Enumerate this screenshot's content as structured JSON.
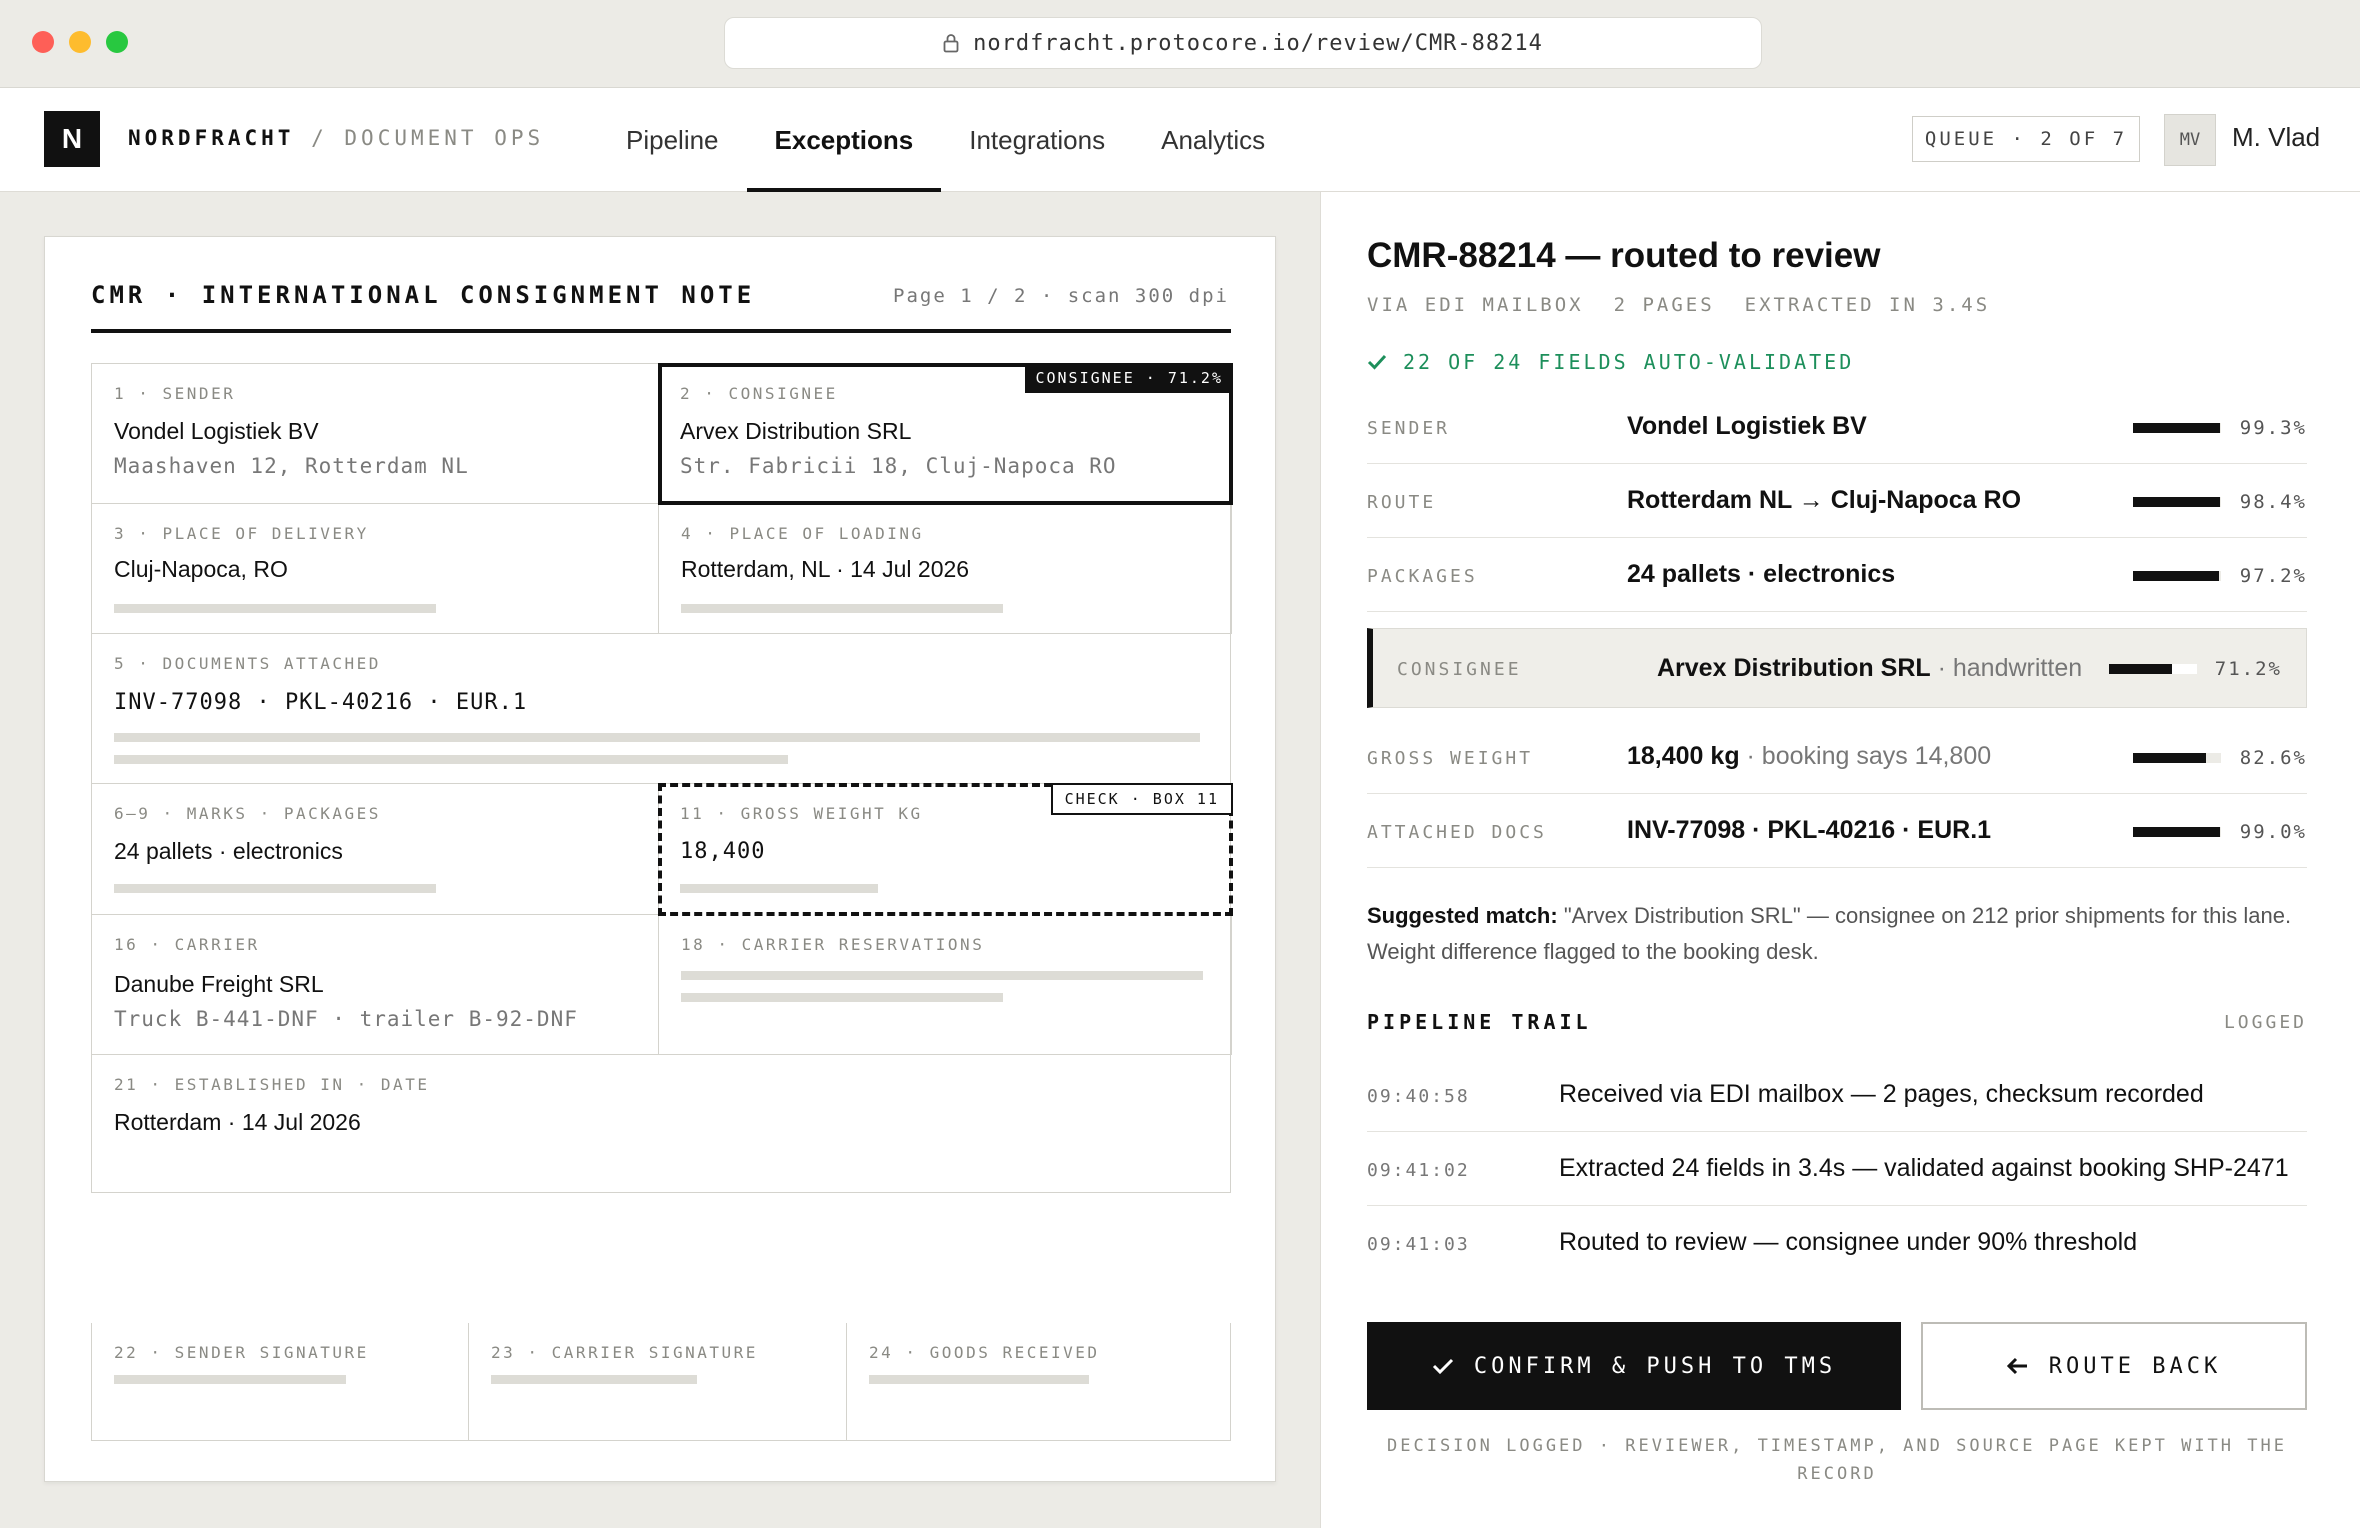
{
  "browser": {
    "url": "nordfracht.protocore.io/review/CMR-88214"
  },
  "header": {
    "logo": "N",
    "brand": "NORDFRACHT",
    "brand_sep": "/",
    "section": "DOCUMENT OPS",
    "nav": [
      "Pipeline",
      "Exceptions",
      "Integrations",
      "Analytics"
    ],
    "active_nav": "Exceptions",
    "queue": "QUEUE · 2 OF 7",
    "avatar": "MV",
    "user": "M. Vlad"
  },
  "document": {
    "title": "CMR · INTERNATIONAL CONSIGNMENT NOTE",
    "meta": "Page 1 / 2 · scan 300 dpi",
    "boxes": {
      "sender": {
        "label": "1 · SENDER",
        "name": "Vondel Logistiek BV",
        "address": "Maashaven 12, Rotterdam NL"
      },
      "consignee": {
        "label": "2 · CONSIGNEE",
        "name": "Arvex Distribution SRL",
        "address": "Str. Fabricii 18, Cluj-Napoca RO",
        "tag": "CONSIGNEE · 71.2%"
      },
      "delivery": {
        "label": "3 · PLACE OF DELIVERY",
        "value": "Cluj-Napoca, RO"
      },
      "loading": {
        "label": "4 · PLACE OF LOADING",
        "value": "Rotterdam, NL · 14 Jul 2026"
      },
      "documents": {
        "label": "5 · DOCUMENTS ATTACHED",
        "value": "INV-77098 · PKL-40216 · EUR.1"
      },
      "packages": {
        "label": "6–9 · MARKS · PACKAGES",
        "value": "24 pallets · electronics"
      },
      "weight": {
        "label": "11 · GROSS WEIGHT KG",
        "value": "18,400",
        "tag": "CHECK · BOX 11"
      },
      "carrier": {
        "label": "16 · CARRIER",
        "name": "Danube Freight SRL",
        "detail": "Truck B-441-DNF · trailer B-92-DNF"
      },
      "reservations": {
        "label": "18 · CARRIER RESERVATIONS"
      },
      "established": {
        "label": "21 · ESTABLISHED IN · DATE",
        "value": "Rotterdam · 14 Jul 2026"
      }
    },
    "signatures": [
      "22 · SENDER SIGNATURE",
      "23 · CARRIER SIGNATURE",
      "24 · GOODS RECEIVED"
    ]
  },
  "review": {
    "title": "CMR-88214 — routed to review",
    "meta": [
      "VIA EDI MAILBOX",
      "2 PAGES",
      "EXTRACTED IN 3.4S"
    ],
    "validated": "22 OF 24 FIELDS AUTO-VALIDATED",
    "colors": {
      "ok": "#1d8f5b",
      "ink": "#111111"
    },
    "fields": [
      {
        "label": "SENDER",
        "value": "Vondel Logistiek BV",
        "note": "",
        "confidence": "99.3%",
        "level": 0.993
      },
      {
        "label": "ROUTE",
        "value": "Rotterdam NL → Cluj-Napoca RO",
        "note": "",
        "confidence": "98.4%",
        "level": 0.984
      },
      {
        "label": "PACKAGES",
        "value": "24 pallets · electronics",
        "note": "",
        "confidence": "97.2%",
        "level": 0.972
      },
      {
        "label": "CONSIGNEE",
        "value": "Arvex Distribution SRL",
        "note": " · handwritten",
        "confidence": "71.2%",
        "level": 0.712,
        "flagged": true
      },
      {
        "label": "GROSS WEIGHT",
        "value": "18,400 kg",
        "note": " · booking says 14,800",
        "confidence": "82.6%",
        "level": 0.826
      },
      {
        "label": "ATTACHED DOCS",
        "value": "INV-77098 · PKL-40216 · EUR.1",
        "note": "",
        "confidence": "99.0%",
        "level": 0.99
      }
    ],
    "suggest_label": "Suggested match:",
    "suggest_text": " \"Arvex Distribution SRL\" — consignee on 212 prior shipments for this lane. Weight difference flagged to the booking desk.",
    "trail_title": "PIPELINE TRAIL",
    "trail_logged": "LOGGED",
    "trail": [
      {
        "time": "09:40:58",
        "text": "Received via EDI mailbox — 2 pages, checksum recorded"
      },
      {
        "time": "09:41:02",
        "text": "Extracted 24 fields in 3.4s — validated against booking SHP-2471"
      },
      {
        "time": "09:41:03",
        "text": "Routed to review — consignee under 90% threshold"
      }
    ],
    "confirm_label": "CONFIRM & PUSH TO TMS",
    "route_back_label": "ROUTE BACK",
    "footnote": "DECISION LOGGED · REVIEWER, TIMESTAMP, AND SOURCE PAGE KEPT WITH THE RECORD"
  }
}
